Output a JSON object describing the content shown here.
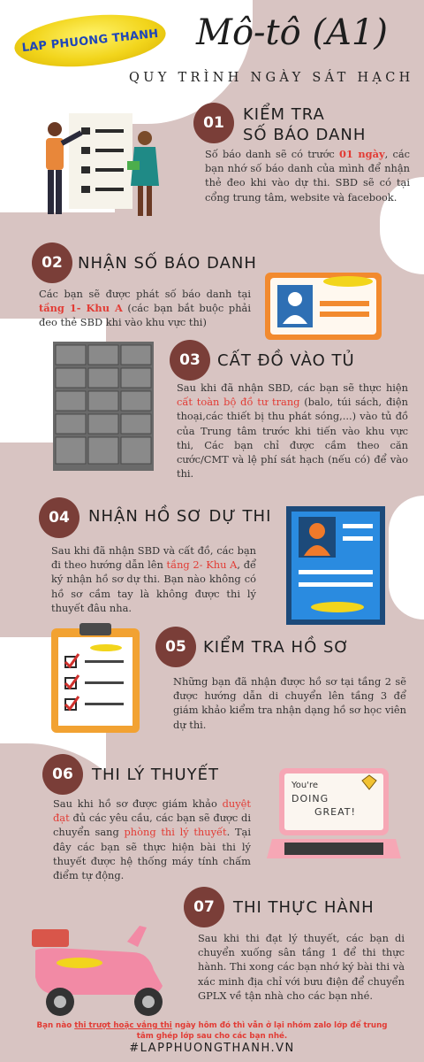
{
  "brand": {
    "logo_text": "LAP PHUONG THANH"
  },
  "header": {
    "title": "Mô-tô (A1)",
    "subtitle": "QUY TRÌNH NGÀY SÁT HẠCH"
  },
  "steps": [
    {
      "num": "01",
      "title_line1": "KIỂM TRA",
      "title_line2": "SỐ BÁO DANH",
      "text_a": "Số báo danh sẽ có trước ",
      "text_hl": "01 ngày",
      "text_b": ", các bạn nhớ số báo danh của mình để nhận thẻ đeo khi vào dự thi. SBD sẽ có tại cổng trung tâm, website và facebook."
    },
    {
      "num": "02",
      "title": "NHẬN SỐ BÁO DANH",
      "text_a": "Các bạn sẽ được phát số báo danh tại ",
      "text_hl": "tầng 1- Khu A",
      "text_b": " (các bạn bắt buộc phải đeo thẻ SBD khi vào khu vực thi)"
    },
    {
      "num": "03",
      "title": "CẤT ĐỒ VÀO TỦ",
      "text_a": "Sau khi đã nhận SBD, các bạn sẽ thực hiện ",
      "text_hl": "cất toàn bộ đồ  tư trang",
      "text_b": " (balo, túi sách, điện thoại,các thiết bị thu phát sóng,...) vào tủ đồ của Trung tâm trước khi tiến vào khu vực thi, Các bạn chỉ được cầm theo căn cước/CMT và lệ phí sát hạch (nếu có) để vào thi."
    },
    {
      "num": "04",
      "title": "NHẬN HỒ SƠ DỰ THI",
      "text_a": "Sau khi đã nhận SBD và cất đồ, các bạn đi theo hướng dẫn lên ",
      "text_hl": "tầng 2- Khu A",
      "text_b": ", để ký nhận hồ sơ dự thi. Bạn nào không có hồ sơ cầm tay là không được thi lý thuyết đâu nha."
    },
    {
      "num": "05",
      "title": "KIỂM TRA HỒ SƠ",
      "text": "Những bạn đã nhận được hồ sơ tại tầng 2 sẽ được hướng dẫn di chuyển lên tầng 3 để giám khảo kiểm tra nhận dạng hồ sơ học viên dự thi."
    },
    {
      "num": "06",
      "title": "THI LÝ THUYẾT",
      "text_a": "Sau khi hồ sơ được giám khảo ",
      "text_hl1": "duyệt đạt",
      "text_b": " đủ các yêu cầu, các bạn sẽ được di chuyển sang ",
      "text_hl2": "phòng thi lý thuyết",
      "text_c": ". Tại đây các bạn sẽ thực hiện bài thi lý thuyết được hệ thống máy tính chấm điểm tự động."
    },
    {
      "num": "07",
      "title": "THI THỰC HÀNH",
      "text": "Sau khi thi đạt lý thuyết, các bạn di chuyển xuống sân tầng 1 để thi thực hành. Thi xong các bạn nhớ ký bài thi và xác minh địa chỉ với bưu điện để chuyển GPLX về tận nhà cho các bạn nhé."
    }
  ],
  "illustrations": {
    "laptop_line1": "You're",
    "laptop_line2": "DOING",
    "laptop_line3": "GREAT!",
    "card_logo_text": "LAP PHUONG THANH"
  },
  "footer": {
    "note_a": "Bạn nào ",
    "note_u": "thi trượt hoặc vắng thi",
    "note_b": " ngày hôm đó thì vẫn ở lại nhóm zalo lớp để trung tâm ghép lớp sau cho các bạn nhé.",
    "hashtag": "#LAPPHUONGTHANH.VN"
  },
  "colors": {
    "accent": "#7a3e38",
    "blob": "#d8c4c2",
    "highlight": "#e23b34",
    "logo_text": "#1f46b8"
  },
  "icons": [
    "people-checklist-icon",
    "id-card-icon",
    "locker-icon",
    "profile-document-icon",
    "checklist-clipboard-icon",
    "laptop-icon",
    "scooter-icon"
  ]
}
